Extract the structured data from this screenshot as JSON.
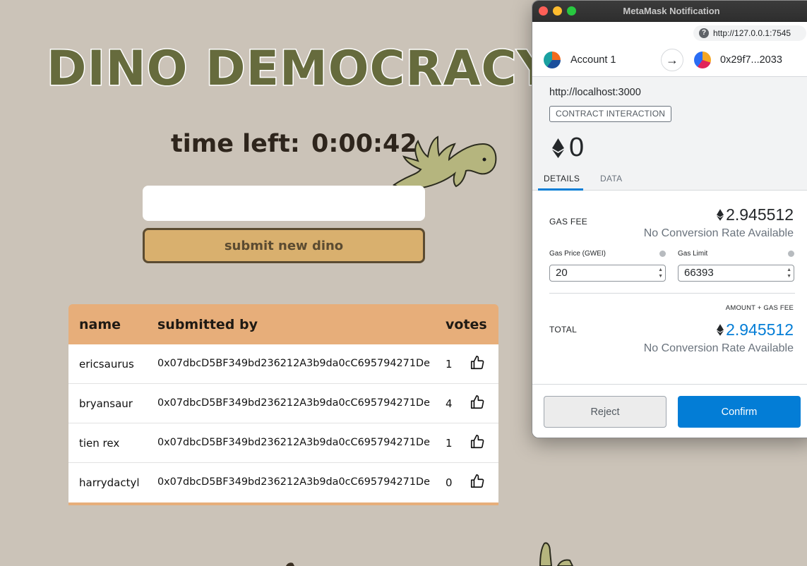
{
  "app": {
    "title": "DINO DEMOCRACY",
    "timer_label": "time left:",
    "timer_value": "0:00:42",
    "input_value": "",
    "submit_label": "submit new dino",
    "table": {
      "headers": [
        "name",
        "submitted by",
        "votes"
      ],
      "rows": [
        {
          "name": "ericsaurus",
          "submitted_by": "0x07dbcD5BF349bd236212A3b9da0cC695794271De",
          "votes": "1"
        },
        {
          "name": "bryansaur",
          "submitted_by": "0x07dbcD5BF349bd236212A3b9da0cC695794271De",
          "votes": "4"
        },
        {
          "name": "tien rex",
          "submitted_by": "0x07dbcD5BF349bd236212A3b9da0cC695794271De",
          "votes": "1"
        },
        {
          "name": "harrydactyl",
          "submitted_by": "0x07dbcD5BF349bd236212A3b9da0cC695794271De",
          "votes": "0"
        }
      ]
    },
    "icons": {
      "vote": "thumbs-up-icon"
    }
  },
  "metamask": {
    "window_title": "MetaMask Notification",
    "url": "http://127.0.0.1:7545",
    "from_account": "Account 1",
    "to_account": "0x29f7...2033",
    "origin": "http://localhost:3000",
    "badge": "CONTRACT INTERACTION",
    "amount": "0",
    "tabs": [
      "DETAILS",
      "DATA"
    ],
    "active_tab": "DETAILS",
    "gas_fee_label": "GAS FEE",
    "gas_fee_value": "2.945512",
    "no_conversion": "No Conversion Rate Available",
    "gas_price_label": "Gas Price (GWEI)",
    "gas_price_value": "20",
    "gas_limit_label": "Gas Limit",
    "gas_limit_value": "66393",
    "amount_gas_label": "AMOUNT + GAS FEE",
    "total_label": "TOTAL",
    "total_value": "2.945512",
    "reject_label": "Reject",
    "confirm_label": "Confirm"
  },
  "colors": {
    "page_bg": "#cbc3b8",
    "title_green": "#666b3d",
    "table_header": "#e7ae7a",
    "submit_bg": "#d9b06e",
    "mm_blue": "#037dd6"
  }
}
